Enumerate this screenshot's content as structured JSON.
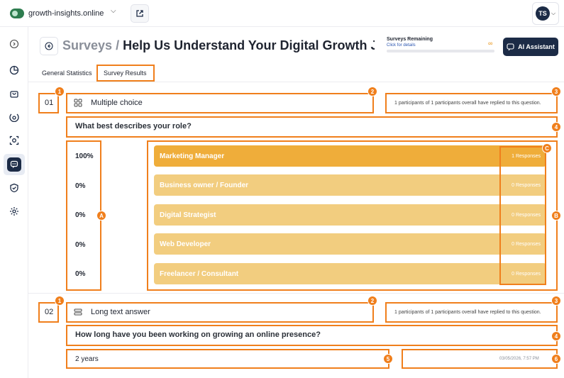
{
  "topbar": {
    "site_name": "growth-insights.online",
    "avatar_initials": "TS"
  },
  "header": {
    "breadcrumb_root": "Surveys",
    "breadcrumb_sep": " / ",
    "survey_title": "Help Us Understand Your Digital Growth Jou...",
    "remaining_title": "Surveys Remaining",
    "remaining_link": "Click for details",
    "remaining_value": "∞",
    "ai_button": "AI Assistant"
  },
  "tabs": [
    {
      "label": "General Statistics"
    },
    {
      "label": "Survey Results"
    }
  ],
  "questions": [
    {
      "number": "01",
      "type_label": "Multiple choice",
      "meta": "1 participants of 1 participants overall have replied to this question.",
      "text": "What best describes your role?",
      "options": [
        {
          "percent": "100%",
          "label": "Marketing Manager",
          "responses": "1 Responses"
        },
        {
          "percent": "0%",
          "label": "Business owner / Founder",
          "responses": "0 Responses"
        },
        {
          "percent": "0%",
          "label": "Digital Strategist",
          "responses": "0 Responses"
        },
        {
          "percent": "0%",
          "label": "Web Developer",
          "responses": "0 Responses"
        },
        {
          "percent": "0%",
          "label": "Freelancer / Consultant",
          "responses": "0 Responses"
        }
      ]
    },
    {
      "number": "02",
      "type_label": "Long text answer",
      "meta": "1 participants of 1 participants overall have replied to this question.",
      "text": "How long have you been working on growing an online presence?",
      "answer": "2 years",
      "timestamp": "03/05/2026, 7:57 PM"
    }
  ],
  "annotations": {
    "b1": "1",
    "b2": "2",
    "b3": "3",
    "b4": "4",
    "b5": "5",
    "b6": "6",
    "bA": "A",
    "bB": "B",
    "bC": "C"
  },
  "colors": {
    "accent": "#f07f1c",
    "navy": "#1c2b46",
    "bar_top": "#efad3a",
    "bar_rest": "#f2cd7f"
  }
}
